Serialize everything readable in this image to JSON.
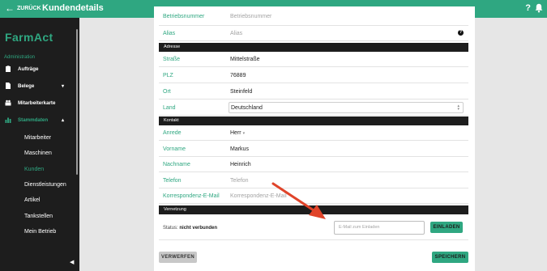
{
  "topbar": {
    "back_label": "ZURÜCK",
    "title": "Kundendetails",
    "help": "?"
  },
  "sidebar": {
    "logo": "FarmAct",
    "section": "Administration",
    "items": [
      {
        "label": "Aufträge"
      },
      {
        "label": "Belege",
        "chevron": "▾"
      },
      {
        "label": "Mitarbeiterkarte"
      },
      {
        "label": "Stammdaten",
        "chevron": "▴"
      }
    ],
    "sub_items": [
      "Mitarbeiter",
      "Maschinen",
      "Kunden",
      "Dienstleistungen",
      "Artikel",
      "Tankstellen",
      "Mein Betrieb"
    ],
    "active_sub": "Kunden",
    "collapse": "◀"
  },
  "form": {
    "betriebsnummer": {
      "label": "Betriebsnummer",
      "placeholder": "Betriebsnummer"
    },
    "alias": {
      "label": "Alias",
      "placeholder": "Alias",
      "info": "?"
    },
    "sections": {
      "adresse": "Adresse",
      "kontakt": "Kontakt",
      "vernetzung": "Vernetzung"
    },
    "strasse": {
      "label": "Straße",
      "value": "Mittelstraße"
    },
    "plz": {
      "label": "PLZ",
      "value": "76889"
    },
    "ort": {
      "label": "Ort",
      "value": "Steinfeld"
    },
    "land": {
      "label": "Land",
      "value": "Deutschland"
    },
    "anrede": {
      "label": "Anrede",
      "value": "Herr"
    },
    "vorname": {
      "label": "Vorname",
      "value": "Markus"
    },
    "nachname": {
      "label": "Nachname",
      "value": "Heinrich"
    },
    "telefon": {
      "label": "Telefon",
      "placeholder": "Telefon"
    },
    "email": {
      "label": "Korrespondenz-E-Mail",
      "placeholder": "Korrespondenz-E-Mail"
    }
  },
  "vernetzung": {
    "status_prefix": "Status:",
    "status_value": "nicht verbunden",
    "email_placeholder": "E-Mail zum Einladen",
    "invite_label": "EINLADEN"
  },
  "actions": {
    "discard": "VERWERFEN",
    "save": "SPEICHERN"
  },
  "colors": {
    "accent": "#2fa781",
    "dark": "#1d1d1d",
    "annotation": "#e0442a"
  }
}
